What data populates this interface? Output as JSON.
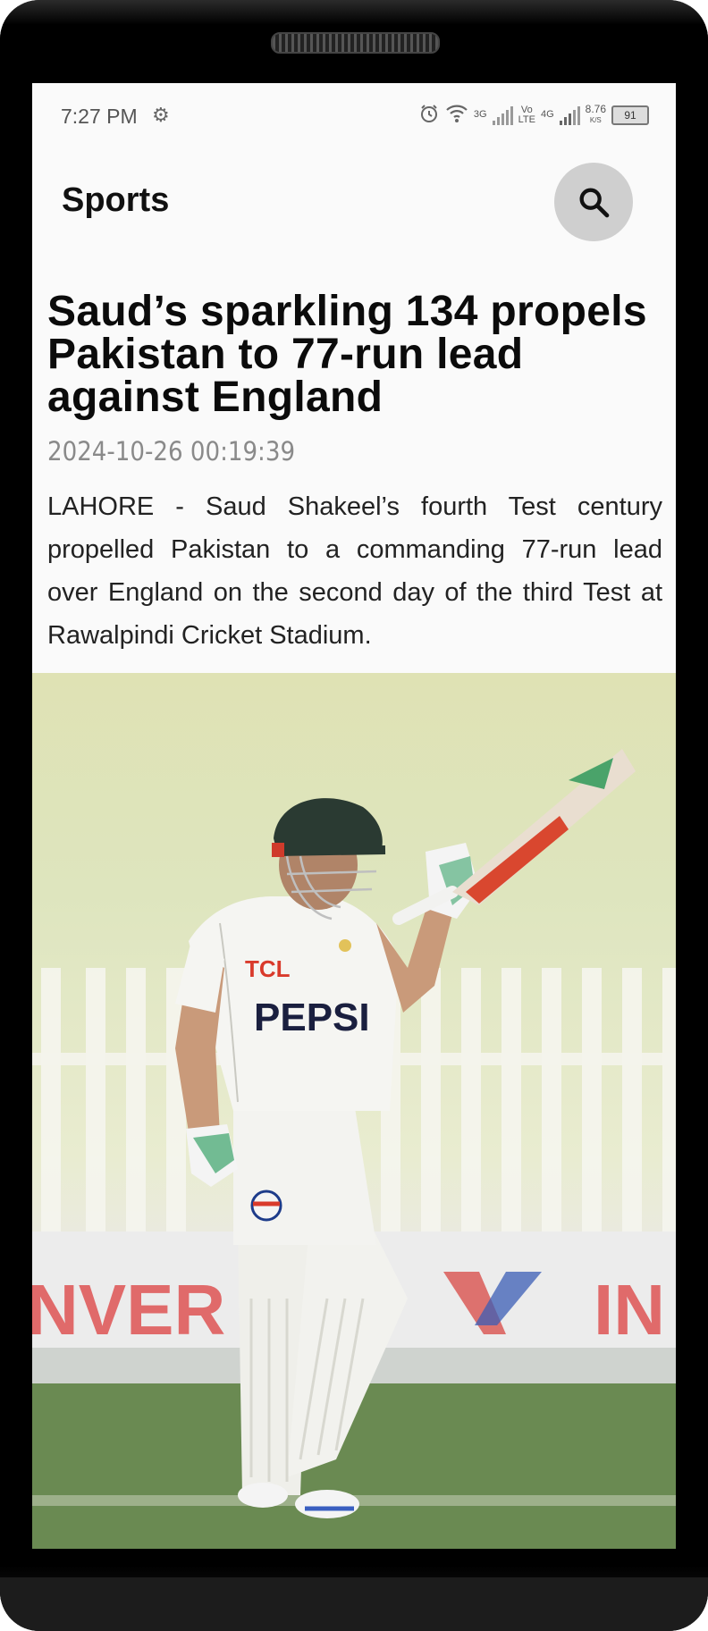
{
  "status_bar": {
    "time": "7:27 PM",
    "net1": "3G",
    "volte_top": "Vo",
    "volte_bottom": "LTE",
    "net2": "4G",
    "speed_value": "8.76",
    "speed_unit": "K/S",
    "battery": "91"
  },
  "app_bar": {
    "title": "Sports"
  },
  "article": {
    "title": "Saud’s sparkling 134 propels Pakistan to 77-run lead against England",
    "date": "2024-10-26 00:19:39",
    "summary": "LAHORE - Saud Shakeel’s fourth Test century propelled Pakistan to a commanding 77-run lead over England on the second day of the third Test at Rawalpindi Cricket Stadium.",
    "image": {
      "shirt_sponsor_1": "TCL",
      "shirt_sponsor_2": "PEPSI",
      "board_left": "NVER",
      "board_right": "IN"
    }
  },
  "colors": {
    "screen_bg": "#fafafa",
    "search_button_bg": "#cfcfcf",
    "title_text": "#0b0b0b",
    "date_text": "#8a8a8a"
  }
}
